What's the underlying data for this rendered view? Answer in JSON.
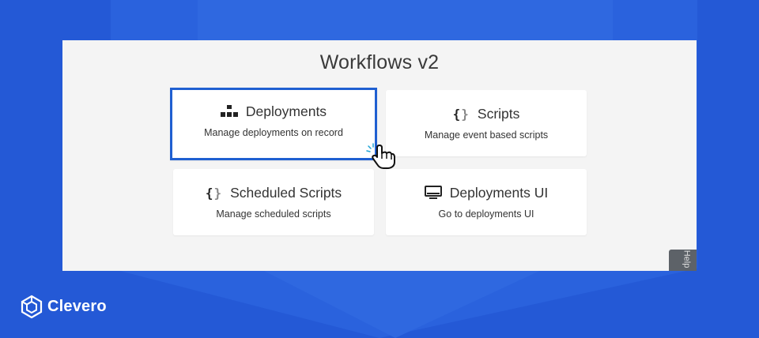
{
  "page": {
    "title": "Workflows v2"
  },
  "cards": [
    {
      "label": "Deployments",
      "description": "Manage deployments on record",
      "icon": "sitemap-icon",
      "selected": true
    },
    {
      "label": "Scripts",
      "description": "Manage event based scripts",
      "icon": "code-braces-icon",
      "selected": false
    },
    {
      "label": "Scheduled Scripts",
      "description": "Manage scheduled scripts",
      "icon": "code-braces-icon",
      "selected": false
    },
    {
      "label": "Deployments UI",
      "description": "Go to deployments UI",
      "icon": "monitor-icon",
      "selected": false
    }
  ],
  "help_tab": {
    "label": "Help"
  },
  "brand": {
    "name": "Clevero",
    "logo_icon": "cube-icon"
  },
  "colors": {
    "background": "#2459d6",
    "panel": "#f4f4f4",
    "selected_border": "#1f5fd1",
    "card": "#ffffff"
  }
}
